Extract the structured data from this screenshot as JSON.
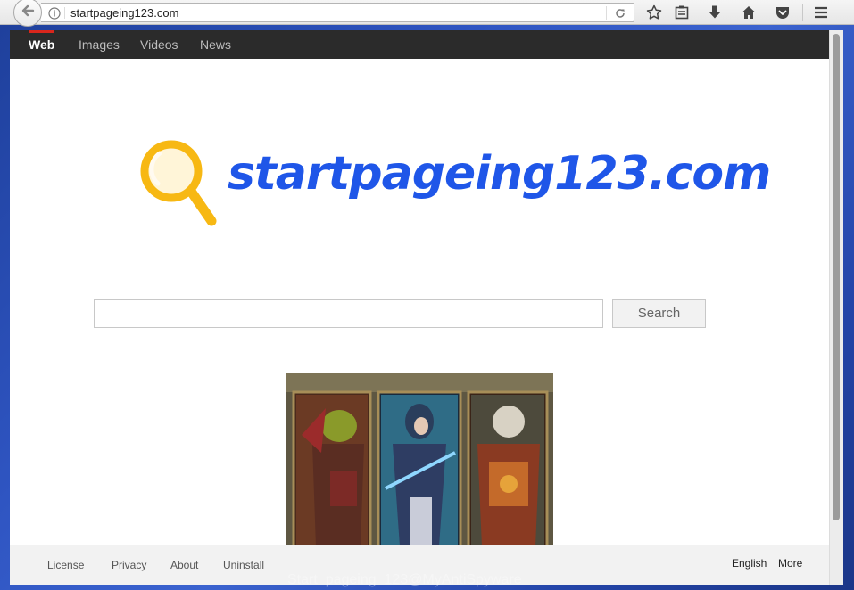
{
  "browser": {
    "url": "startpageing123.com"
  },
  "nav": {
    "tabs": [
      {
        "label": "Web",
        "active": true
      },
      {
        "label": "Images",
        "active": false
      },
      {
        "label": "Videos",
        "active": false
      },
      {
        "label": "News",
        "active": false
      }
    ]
  },
  "logo": {
    "text": "startpageing123.com",
    "color": "#1f56e8",
    "icon_color": "#f7b813"
  },
  "search": {
    "value": "",
    "placeholder": "",
    "button_label": "Search"
  },
  "footer": {
    "links": [
      "License",
      "Privacy",
      "About",
      "Uninstall"
    ],
    "language": "English",
    "more": "More"
  },
  "watermark": "Start_pageing_123@MyAntiSpyware",
  "icons": {
    "back": "back-arrow-icon",
    "info": "info-icon",
    "reload": "reload-icon",
    "bookmark": "star-icon",
    "reading_list": "clipboard-icon",
    "downloads": "download-arrow-icon",
    "home": "home-icon",
    "pocket": "pocket-icon",
    "menu": "hamburger-menu-icon"
  }
}
